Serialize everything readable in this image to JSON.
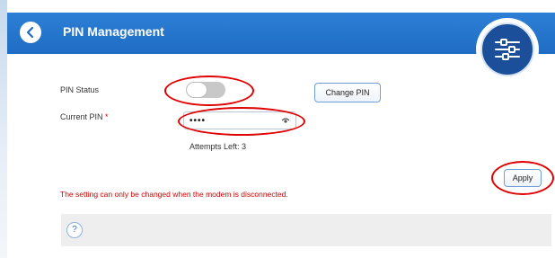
{
  "header": {
    "title": "PIN Management",
    "back_icon": "back-arrow-icon",
    "badge_icon": "sliders-settings-icon",
    "color": "#1f6cc4"
  },
  "pin_status": {
    "label": "PIN Status",
    "enabled": false,
    "change_pin_label": "Change PIN"
  },
  "current_pin": {
    "label": "Current PIN",
    "required_mark": "*",
    "masked_value": "••••",
    "eye_icon": "show-password-icon"
  },
  "attempts_left": "Attempts Left: 3",
  "apply_label": "Apply",
  "warning": "The setting can only be changed when the modem is disconnected.",
  "help": {
    "icon_text": "?",
    "icon": "help-icon"
  },
  "annotation_color": "#e00000"
}
